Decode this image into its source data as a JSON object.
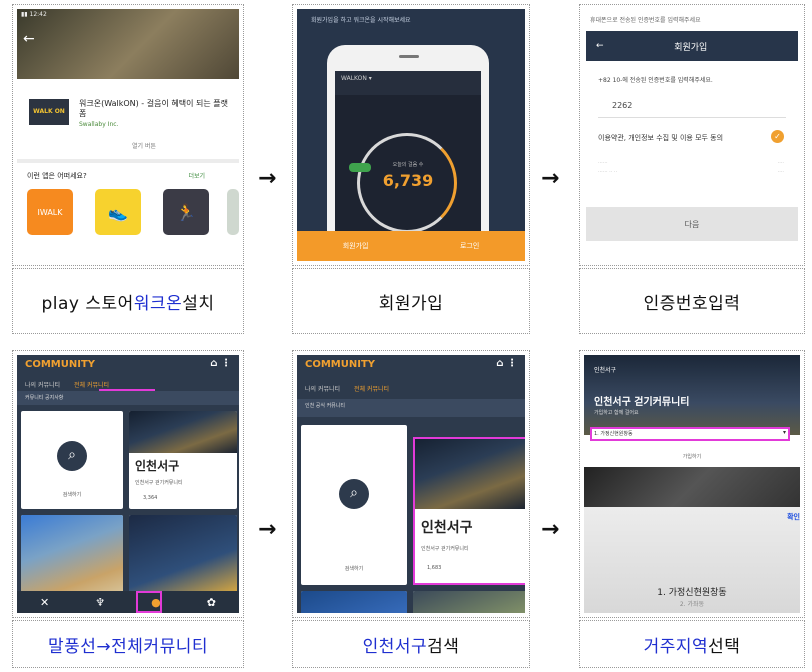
{
  "captions": {
    "c1_prefix": "play 스토어 ",
    "c1_highlight": "워크온",
    "c1_suffix": " 설치",
    "c2": "회원가입",
    "c3": "인증번호입력",
    "c4": "말풍선→전체커뮤니티",
    "c5_highlight": "인천서구",
    "c5_suffix": " 검색",
    "c6_highlight": "거주지역",
    "c6_suffix": " 선택"
  },
  "arrows": [
    "→",
    "→",
    "→",
    "→"
  ],
  "screen1": {
    "app_name": "워크온(WalkON) - 걸음이 혜택이 되는 플랫폼",
    "developer": "Swallaby Inc.",
    "open": "열기 버튼",
    "section": "이런 앱은 어떠세요?",
    "more": "더보기",
    "logo_text": "WALK ON",
    "rec1_text": "IWALK"
  },
  "screen2": {
    "hint": "회원가입을 하고 워크온을 시작해보세요",
    "step_label": "오늘의 걸음 수",
    "steps": "6,739",
    "signup": "회원가입",
    "login": "로그인"
  },
  "screen3": {
    "hint": "휴대폰으로 전송된 인증번호를 입력해주세요",
    "title": "회원가입",
    "message": "+82 10-에 전송된 인증번호를 입력해주세요.",
    "code": "2262",
    "agree": "이용약관, 개인정보 수집 및 이용 모두 동의",
    "next": "다음"
  },
  "screen4": {
    "title": "COMMUNITY",
    "tab_mine": "나의 커뮤니티",
    "tab_all": "전체 커뮤니티",
    "notice": "커뮤니티 공지사항",
    "search_label": "검색하기",
    "logo": "인천서구",
    "community_name": "인천서구 걷기커뮤니티",
    "members": "3,364"
  },
  "screen5": {
    "title": "COMMUNITY",
    "tab_mine": "나의 커뮤니티",
    "tab_all": "전체 커뮤니티",
    "notice": "인천 공식 커뮤니티",
    "search_label": "검색하기",
    "logo": "인천서구",
    "community_name": "인천서구 걷기커뮤니티",
    "members": "1,683"
  },
  "screen6": {
    "breadcrumb": "인천서구",
    "title": "인천서구 걷기커뮤니티",
    "subtitle": "가입하고 함께 걸어요",
    "dropdown": "1. 가정신현원창동",
    "join": "가입하기",
    "confirm": "확인",
    "region": "1. 가정신현원창동",
    "region_next": "2. 가좌동"
  }
}
